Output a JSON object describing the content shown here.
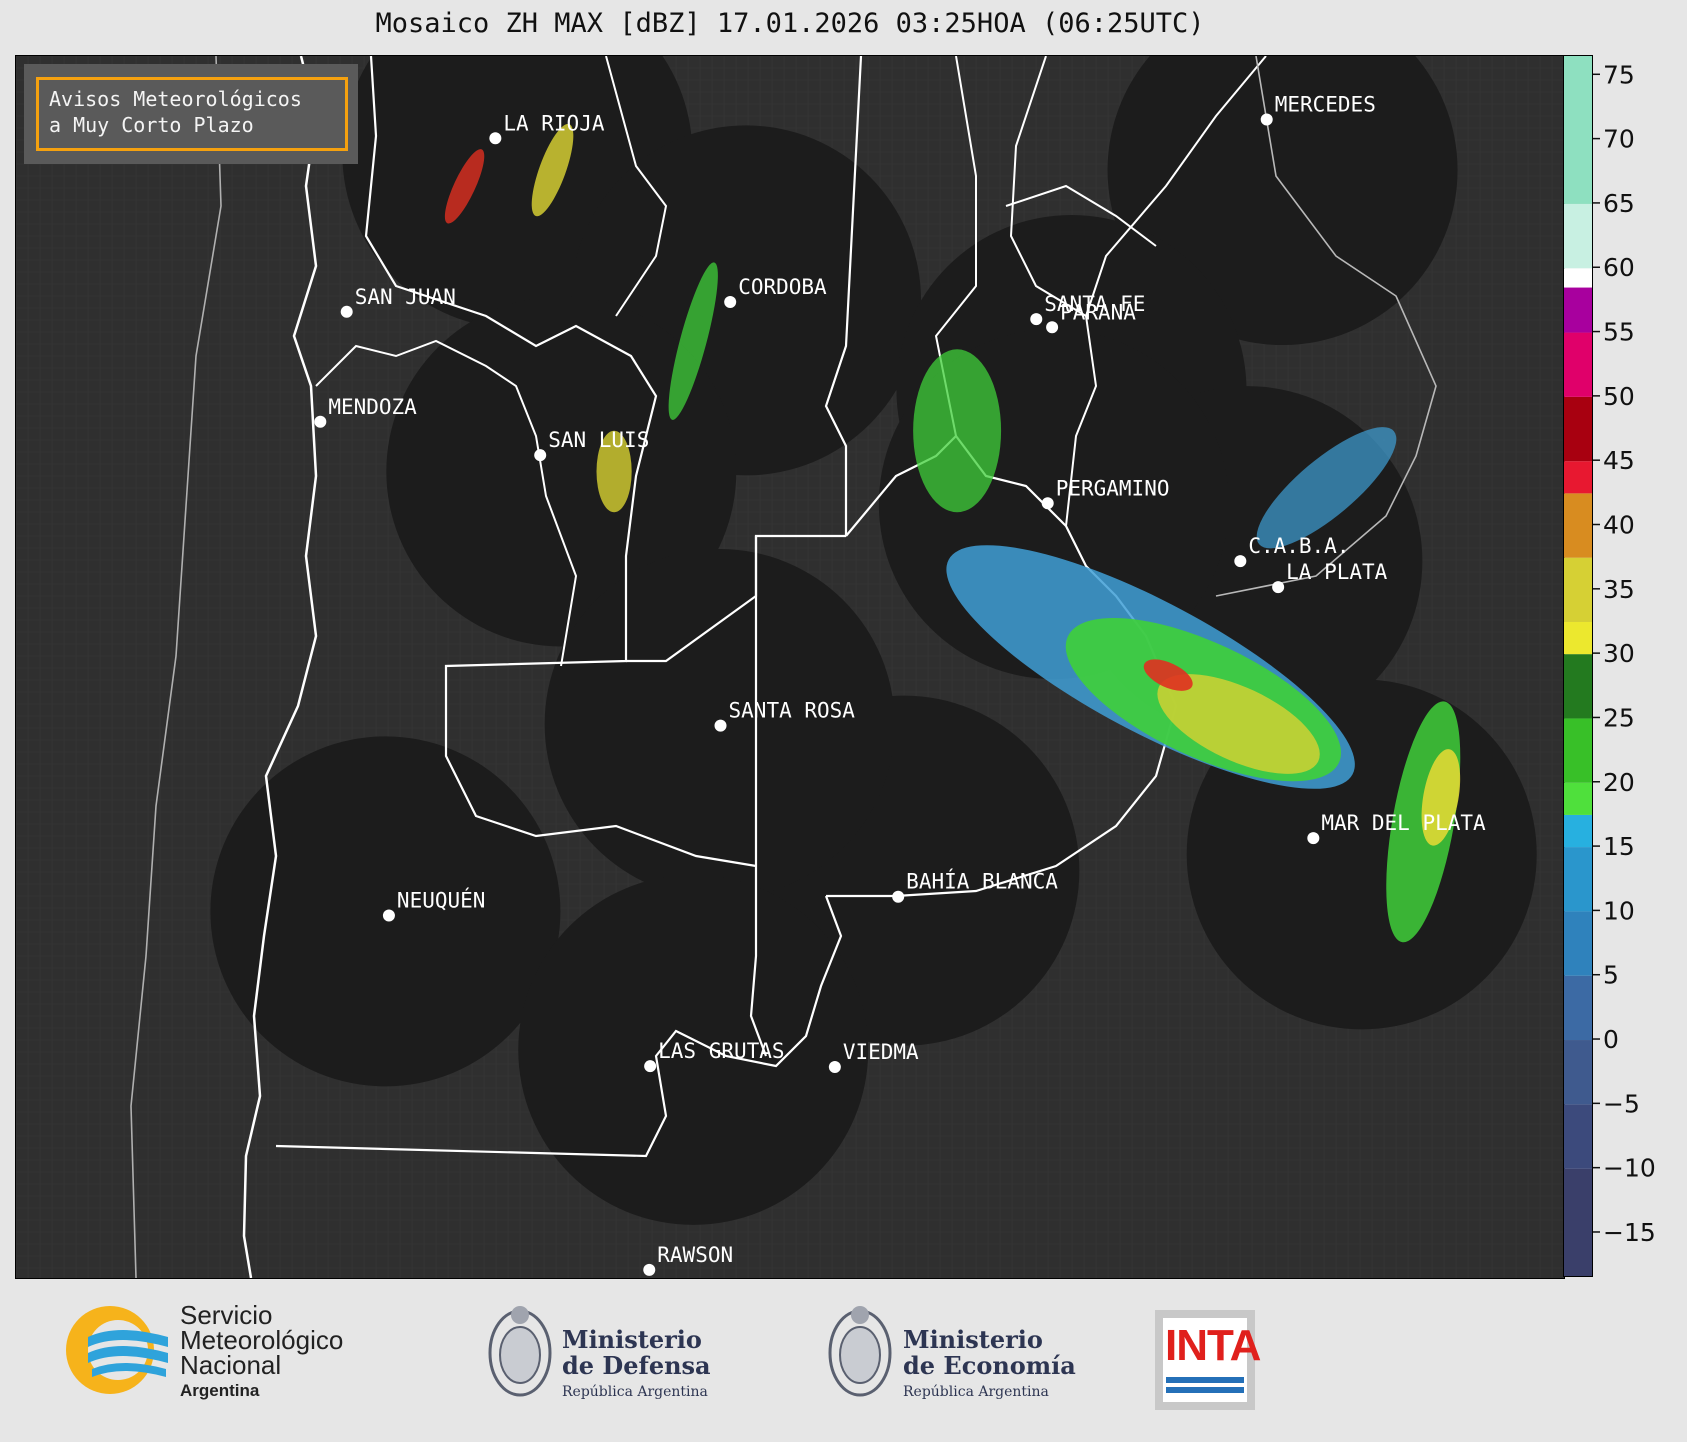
{
  "title": "Mosaico ZH MAX [dBZ] 17.01.2026 03:25HOA (06:25UTC)",
  "alert_box": {
    "line1": "Avisos Meteorológicos",
    "line2": "a Muy Corto Plazo",
    "border_color": "#f5a10f"
  },
  "cities": [
    {
      "name": "LA RIOJA",
      "lon": -66.85,
      "lat": -29.41
    },
    {
      "name": "MERCEDES",
      "lon": -58.08,
      "lat": -29.18
    },
    {
      "name": "CORDOBA",
      "lon": -64.18,
      "lat": -31.42
    },
    {
      "name": "SAN JUAN",
      "lon": -68.54,
      "lat": -31.54
    },
    {
      "name": "SANTA FE",
      "lon": -60.7,
      "lat": -31.63
    },
    {
      "name": "PARANA",
      "lon": -60.52,
      "lat": -31.73
    },
    {
      "name": "MENDOZA",
      "lon": -68.84,
      "lat": -32.89
    },
    {
      "name": "SAN LUIS",
      "lon": -66.34,
      "lat": -33.3
    },
    {
      "name": "PERGAMINO",
      "lon": -60.57,
      "lat": -33.89
    },
    {
      "name": "C.A.B.A.",
      "lon": -58.38,
      "lat": -34.6
    },
    {
      "name": "LA PLATA",
      "lon": -57.95,
      "lat": -34.92
    },
    {
      "name": "SANTA ROSA",
      "lon": -64.29,
      "lat": -36.62
    },
    {
      "name": "MAR DEL PLATA",
      "lon": -57.55,
      "lat": -38.0
    },
    {
      "name": "BAHÍA BLANCA",
      "lon": -62.27,
      "lat": -38.72
    },
    {
      "name": "NEUQUÉN",
      "lon": -68.06,
      "lat": -38.95
    },
    {
      "name": "LAS GRUTAS",
      "lon": -65.09,
      "lat": -40.8
    },
    {
      "name": "VIEDMA",
      "lon": -62.99,
      "lat": -40.81
    },
    {
      "name": "RAWSON",
      "lon": -65.1,
      "lat": -43.3
    }
  ],
  "radars": [
    {
      "name": "radar-la-rioja-area",
      "lon": -66.6,
      "lat": -29.6
    },
    {
      "name": "radar-cordoba-area",
      "lon": -64.0,
      "lat": -31.4
    },
    {
      "name": "radar-mercedes-area",
      "lon": -57.9,
      "lat": -29.8
    },
    {
      "name": "radar-san-luis-area",
      "lon": -66.1,
      "lat": -33.5
    },
    {
      "name": "radar-parana-area",
      "lon": -60.3,
      "lat": -32.5
    },
    {
      "name": "radar-caba-area",
      "lon": -58.3,
      "lat": -34.6
    },
    {
      "name": "radar-pergamino-area",
      "lon": -60.5,
      "lat": -33.9
    },
    {
      "name": "radar-mar-del-plata-area",
      "lon": -57.0,
      "lat": -38.2
    },
    {
      "name": "radar-bahia-blanca-area",
      "lon": -62.2,
      "lat": -38.4
    },
    {
      "name": "radar-santa-rosa-area",
      "lon": -64.3,
      "lat": -36.6
    },
    {
      "name": "radar-neuquen-area",
      "lon": -68.1,
      "lat": -38.9
    },
    {
      "name": "radar-las-grutas-area",
      "lon": -64.6,
      "lat": -40.6
    }
  ],
  "map_extent": {
    "lon_min": -72.3,
    "lon_max": -54.7,
    "lat_min": -43.4,
    "lat_max": -28.4
  },
  "colorbar": {
    "label_unit": "dBZ",
    "min": -18.5,
    "max": 76.5,
    "ticks": [
      "75",
      "70",
      "65",
      "60",
      "55",
      "50",
      "45",
      "40",
      "35",
      "30",
      "25",
      "20",
      "15",
      "10",
      "5",
      "0",
      "−5",
      "−10",
      "−15"
    ],
    "tick_values": [
      75,
      70,
      65,
      60,
      55,
      50,
      45,
      40,
      35,
      30,
      25,
      20,
      15,
      10,
      5,
      0,
      -5,
      -10,
      -15
    ],
    "segments": [
      {
        "from": -18.5,
        "to": -10,
        "color": "#3a3f6a"
      },
      {
        "from": -10,
        "to": -5,
        "color": "#3c4a7c"
      },
      {
        "from": -5,
        "to": 0,
        "color": "#3f5a8e"
      },
      {
        "from": 0,
        "to": 5,
        "color": "#3c6aa4"
      },
      {
        "from": 5,
        "to": 10,
        "color": "#2f82bc"
      },
      {
        "from": 10,
        "to": 15,
        "color": "#2a96cc"
      },
      {
        "from": 15,
        "to": 17.5,
        "color": "#27b0e0"
      },
      {
        "from": 17.5,
        "to": 20,
        "color": "#4fe03c"
      },
      {
        "from": 20,
        "to": 25,
        "color": "#38c028"
      },
      {
        "from": 25,
        "to": 30,
        "color": "#237a1f"
      },
      {
        "from": 30,
        "to": 32.5,
        "color": "#ece82e"
      },
      {
        "from": 32.5,
        "to": 37.5,
        "color": "#d6d034"
      },
      {
        "from": 37.5,
        "to": 42.5,
        "color": "#d88c20"
      },
      {
        "from": 42.5,
        "to": 45,
        "color": "#e81830"
      },
      {
        "from": 45,
        "to": 50,
        "color": "#a80010"
      },
      {
        "from": 50,
        "to": 55,
        "color": "#e0006a"
      },
      {
        "from": 55,
        "to": 58.5,
        "color": "#a8009e"
      },
      {
        "from": 58.5,
        "to": 60,
        "color": "#ffffff"
      },
      {
        "from": 60,
        "to": 65,
        "color": "#c8f0e2"
      },
      {
        "from": 65,
        "to": 76.5,
        "color": "#8ee0c0"
      }
    ]
  },
  "echoes": [
    {
      "lon": -59.4,
      "lat": -35.9,
      "rx": 2.6,
      "ry": 0.8,
      "rot": 28,
      "color": "#3f9fd6",
      "opacity": 0.85
    },
    {
      "lon": -58.8,
      "lat": -36.3,
      "rx": 1.7,
      "ry": 0.7,
      "rot": 25,
      "color": "#3fcf3a",
      "opacity": 0.9
    },
    {
      "lon": -58.4,
      "lat": -36.6,
      "rx": 1.0,
      "ry": 0.45,
      "rot": 25,
      "color": "#d8d232",
      "opacity": 0.8
    },
    {
      "lon": -59.2,
      "lat": -36.0,
      "rx": 0.3,
      "ry": 0.15,
      "rot": 25,
      "color": "#e03020",
      "opacity": 0.9
    },
    {
      "lon": -56.3,
      "lat": -37.8,
      "rx": 0.35,
      "ry": 1.5,
      "rot": 10,
      "color": "#3fcf3a",
      "opacity": 0.85
    },
    {
      "lon": -56.1,
      "lat": -37.5,
      "rx": 0.2,
      "ry": 0.6,
      "rot": 10,
      "color": "#e0d834",
      "opacity": 0.9
    },
    {
      "lon": -61.6,
      "lat": -33.0,
      "rx": 0.5,
      "ry": 1.0,
      "rot": 0,
      "color": "#3fcf3a",
      "opacity": 0.75
    },
    {
      "lon": -64.6,
      "lat": -31.9,
      "rx": 0.15,
      "ry": 1.0,
      "rot": 15,
      "color": "#3fcf3a",
      "opacity": 0.75
    },
    {
      "lon": -66.2,
      "lat": -29.8,
      "rx": 0.15,
      "ry": 0.6,
      "rot": 20,
      "color": "#e0d834",
      "opacity": 0.8
    },
    {
      "lon": -67.2,
      "lat": -30.0,
      "rx": 0.12,
      "ry": 0.5,
      "rot": 25,
      "color": "#e03020",
      "opacity": 0.8
    },
    {
      "lon": -65.5,
      "lat": -33.5,
      "rx": 0.2,
      "ry": 0.5,
      "rot": 0,
      "color": "#d8d232",
      "opacity": 0.8
    },
    {
      "lon": -57.4,
      "lat": -33.7,
      "rx": 1.0,
      "ry": 0.35,
      "rot": -40,
      "color": "#3f9fd6",
      "opacity": 0.7
    }
  ]
}
